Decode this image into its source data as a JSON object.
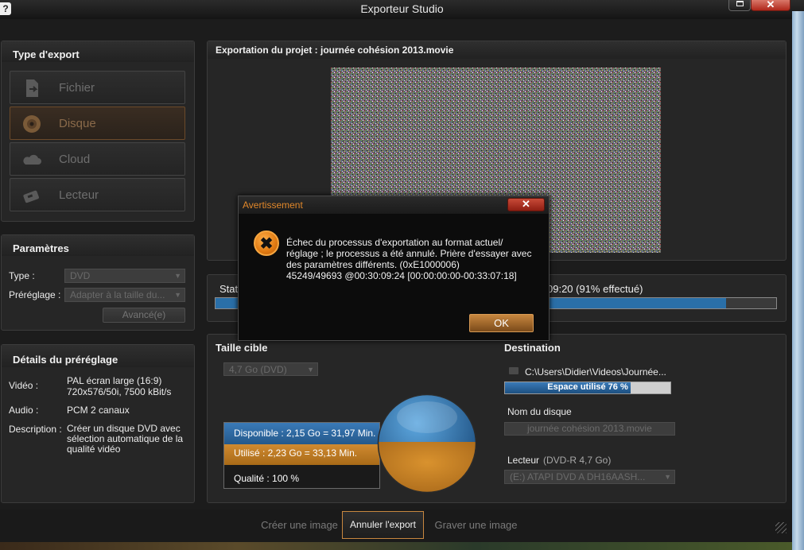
{
  "window": {
    "title": "Exporteur Studio",
    "help": "?",
    "close_glyph": "✕"
  },
  "export_type": {
    "header": "Type d'export",
    "items": [
      {
        "label": "Fichier",
        "icon": "file-export-icon",
        "selected": false
      },
      {
        "label": "Disque",
        "icon": "disc-icon",
        "selected": true
      },
      {
        "label": "Cloud",
        "icon": "cloud-icon",
        "selected": false
      },
      {
        "label": "Lecteur",
        "icon": "device-icon",
        "selected": false
      }
    ]
  },
  "params": {
    "header": "Paramètres",
    "type_label": "Type :",
    "type_value": "DVD",
    "preset_label": "Préréglage :",
    "preset_value": "Adapter à la taille du...",
    "advanced": "Avancé(e)"
  },
  "preset_details": {
    "header": "Détails du préréglage",
    "video_label": "Vidéo :",
    "video_value": "PAL écran large (16:9)\n720x576/50i, 7500 kBit/s",
    "audio_label": "Audio :",
    "audio_value": "PCM 2 canaux",
    "desc_label": "Description :",
    "desc_value": "Créer un disque DVD avec sélection automatique de la qualité vidéo"
  },
  "project": {
    "header": "Exportation du projet : journée cohésion 2013.movie"
  },
  "status": {
    "label": "Stat",
    "text_right": "09:20 (91% effectué)",
    "progress": 0.91
  },
  "target": {
    "header": "Taille cible",
    "size_value": "4,7 Go (DVD)",
    "available": "Disponible : 2,15 Go = 31,97 Min.",
    "used": "Utilisé : 2,23 Go = 33,13 Min.",
    "quality": "Qualité :   100 %"
  },
  "destination": {
    "header": "Destination",
    "path": "C:\\Users\\Didier\\Videos\\Journée...",
    "space_used": "Espace utilisé 76 %",
    "space_fraction": 0.76,
    "disc_name_label": "Nom du disque",
    "disc_name_value": "journée cohésion 2013.movie",
    "drive_label": "Lecteur",
    "drive_type": "(DVD-R 4,7 Go)",
    "drive_value": "(E:) ATAPI   DVD A  DH16AASH..."
  },
  "dialog": {
    "title": "Avertissement",
    "message_l1": "Échec du processus d'exportation au format actuel/",
    "message_l2": "réglage ; le processus a été annulé. Prière d'essayer avec",
    "message_l3": "des paramètres différents. (0xE1000006)",
    "message_l4": "45249/49693 @00:30:09:24  [00:00:00:00-00:33:07:18]",
    "ok": "OK"
  },
  "bottom": {
    "create_image": "Créer une image",
    "cancel_export": "Annuler l'export",
    "burn_image": "Graver une image"
  },
  "colors": {
    "accent": "#e0872a",
    "blue": "#2a6fa8",
    "orange": "#c97f24"
  }
}
